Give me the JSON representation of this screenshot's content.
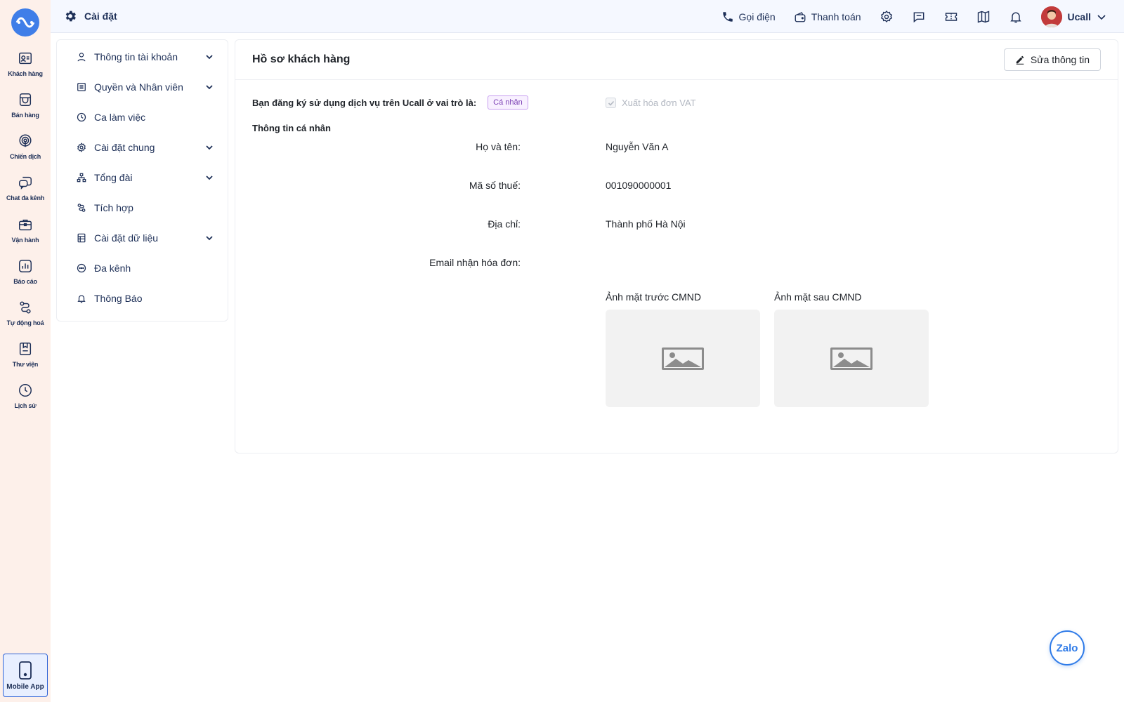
{
  "topbar": {
    "title": "Cài đặt",
    "call_label": "Gọi điện",
    "payment_label": "Thanh toán",
    "user_name": "Ucall"
  },
  "rail": {
    "items": [
      {
        "label": "Khách hàng",
        "icon": "contact-card-icon"
      },
      {
        "label": "Bán hàng",
        "icon": "store-icon"
      },
      {
        "label": "Chiến dịch",
        "icon": "broadcast-icon"
      },
      {
        "label": "Chat đa kênh",
        "icon": "chat-icon"
      },
      {
        "label": "Vận hành",
        "icon": "briefcase-icon"
      },
      {
        "label": "Báo cáo",
        "icon": "report-icon"
      },
      {
        "label": "Tự động hoá",
        "icon": "automation-icon"
      },
      {
        "label": "Thư viện",
        "icon": "library-icon"
      },
      {
        "label": "Lịch sử",
        "icon": "history-icon"
      }
    ],
    "mobile_app_label": "Mobile App"
  },
  "settings_menu": {
    "items": [
      {
        "label": "Thông tin tài khoản",
        "has_children": true
      },
      {
        "label": "Quyền và Nhân viên",
        "has_children": true
      },
      {
        "label": "Ca làm việc",
        "has_children": false
      },
      {
        "label": "Cài đặt chung",
        "has_children": true
      },
      {
        "label": "Tổng đài",
        "has_children": true
      },
      {
        "label": "Tích hợp",
        "has_children": false
      },
      {
        "label": "Cài đặt dữ liệu",
        "has_children": true
      },
      {
        "label": "Đa kênh",
        "has_children": false
      },
      {
        "label": "Thông Báo",
        "has_children": false
      }
    ]
  },
  "profile": {
    "title": "Hồ sơ khách hàng",
    "edit_label": "Sửa thông tin",
    "role_question": "Bạn đăng ký sử dụng dịch vụ trên Ucall ở vai trò là:",
    "role_value": "Cá nhân",
    "vat_label": "Xuất hóa đơn VAT",
    "vat_checked": true,
    "section_title": "Thông tin cá nhân",
    "fields": [
      {
        "label": "Họ và tên:",
        "value": "Nguyễn Văn A"
      },
      {
        "label": "Mã số thuế:",
        "value": "001090000001"
      },
      {
        "label": "Địa chỉ:",
        "value": "Thành phố Hà Nội"
      },
      {
        "label": "Email nhận hóa đơn:",
        "value": ""
      }
    ],
    "id_front_label": "Ảnh mặt trước CMND",
    "id_back_label": "Ảnh mặt sau CMND"
  },
  "zalo_label": "Zalo",
  "colors": {
    "primary": "#1d2f57",
    "accent": "#2f7be8",
    "rail_bg": "#fdf0ea",
    "badge": "#7b3fb4"
  }
}
